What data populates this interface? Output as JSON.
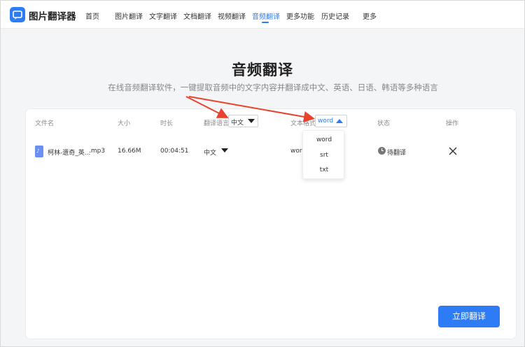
{
  "nav": {
    "app_name": "图片翻译器",
    "items": [
      "首页",
      "图片翻译",
      "文字翻译",
      "文档翻译",
      "视频翻译",
      "音频翻译",
      "更多功能",
      "历史记录",
      "更多"
    ],
    "active_index": 5
  },
  "page": {
    "title": "音频翻译",
    "subtitle": "在线音频翻译软件，一键提取音频中的文字内容并翻译成中文、英语、日语、韩语等多种语言"
  },
  "table": {
    "headers": {
      "filename": "文件名",
      "size": "大小",
      "duration": "时长",
      "language": "翻译语言",
      "format": "文本格式",
      "status": "状态",
      "action": "操作"
    },
    "header_language_select": "中文",
    "header_format_select": "word",
    "row": {
      "filename": "柯林-遗奇_英...",
      "ext": ".mp3",
      "size": "16.66M",
      "duration": "00:04:51",
      "language": "中文",
      "format": "word",
      "status": "待翻译"
    }
  },
  "format_dropdown": {
    "options": [
      "word",
      "srt",
      "txt"
    ]
  },
  "primary_button": "立即翻译",
  "colors": {
    "accent": "#2d7cf6",
    "annotation": "#e8432e",
    "background": "#f4f5f7"
  }
}
